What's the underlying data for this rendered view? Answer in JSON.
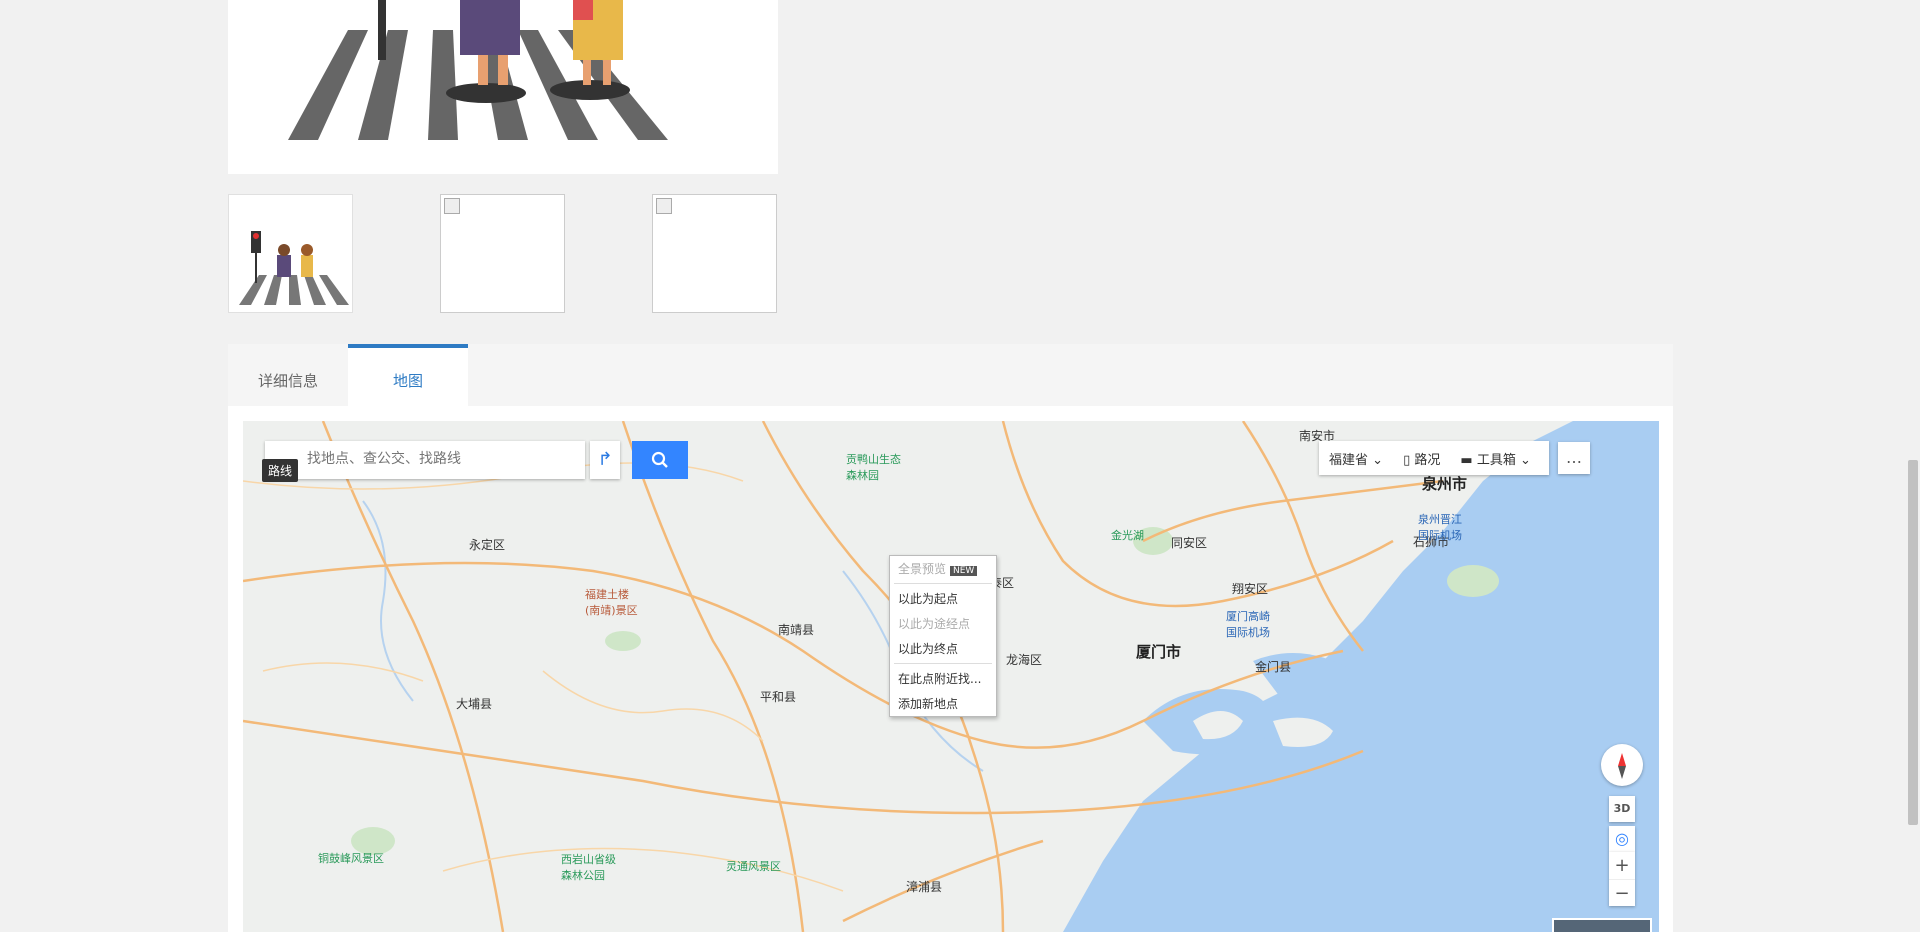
{
  "tabs": [
    {
      "label": "详细信息",
      "active": false
    },
    {
      "label": "地图",
      "active": true
    }
  ],
  "map": {
    "search_placeholder": "找地点、查公交、找路线",
    "tooltip": "路线",
    "toolbar": {
      "province": "福建省",
      "traffic": "路况",
      "toolbox": "工具箱"
    },
    "context_menu": [
      {
        "label": "全景预览",
        "badge": "NEW",
        "disabled": true
      },
      {
        "label": "以此为起点",
        "disabled": false
      },
      {
        "label": "以此为途经点",
        "disabled": true
      },
      {
        "label": "以此为终点",
        "disabled": false
      },
      {
        "label": "在此点附近找...",
        "disabled": false
      },
      {
        "label": "添加新地点",
        "disabled": false
      }
    ],
    "labels": {
      "nanan": "南安市",
      "quanzhou": "泉州市",
      "shishi": "石狮市",
      "quanzhou_airport": "泉州晋江\n国际机场",
      "yongding": "永定区",
      "gongya": "贡鸭山生态\n森林园",
      "jinguanghu": "金光湖",
      "tongan": "同安区",
      "xiangan": "翔安区",
      "xiamen_airport": "厦门高崎\n国际机场",
      "xiamen": "厦门市",
      "jinmen": "金门县",
      "tulou": "福建土楼\n(南靖)景区",
      "nanjing": "南靖县",
      "longhai": "龙海区",
      "jimei": "泰区",
      "pinghe": "平和县",
      "dapu": "大埔县",
      "tonggu": "铜鼓峰风景区",
      "xiyan": "西岩山省级\n森林公园",
      "lingtong": "灵通风景区",
      "zhangpu": "漳浦县"
    },
    "controls": {
      "threed": "3D",
      "zoom_in": "+",
      "zoom_out": "−"
    }
  }
}
